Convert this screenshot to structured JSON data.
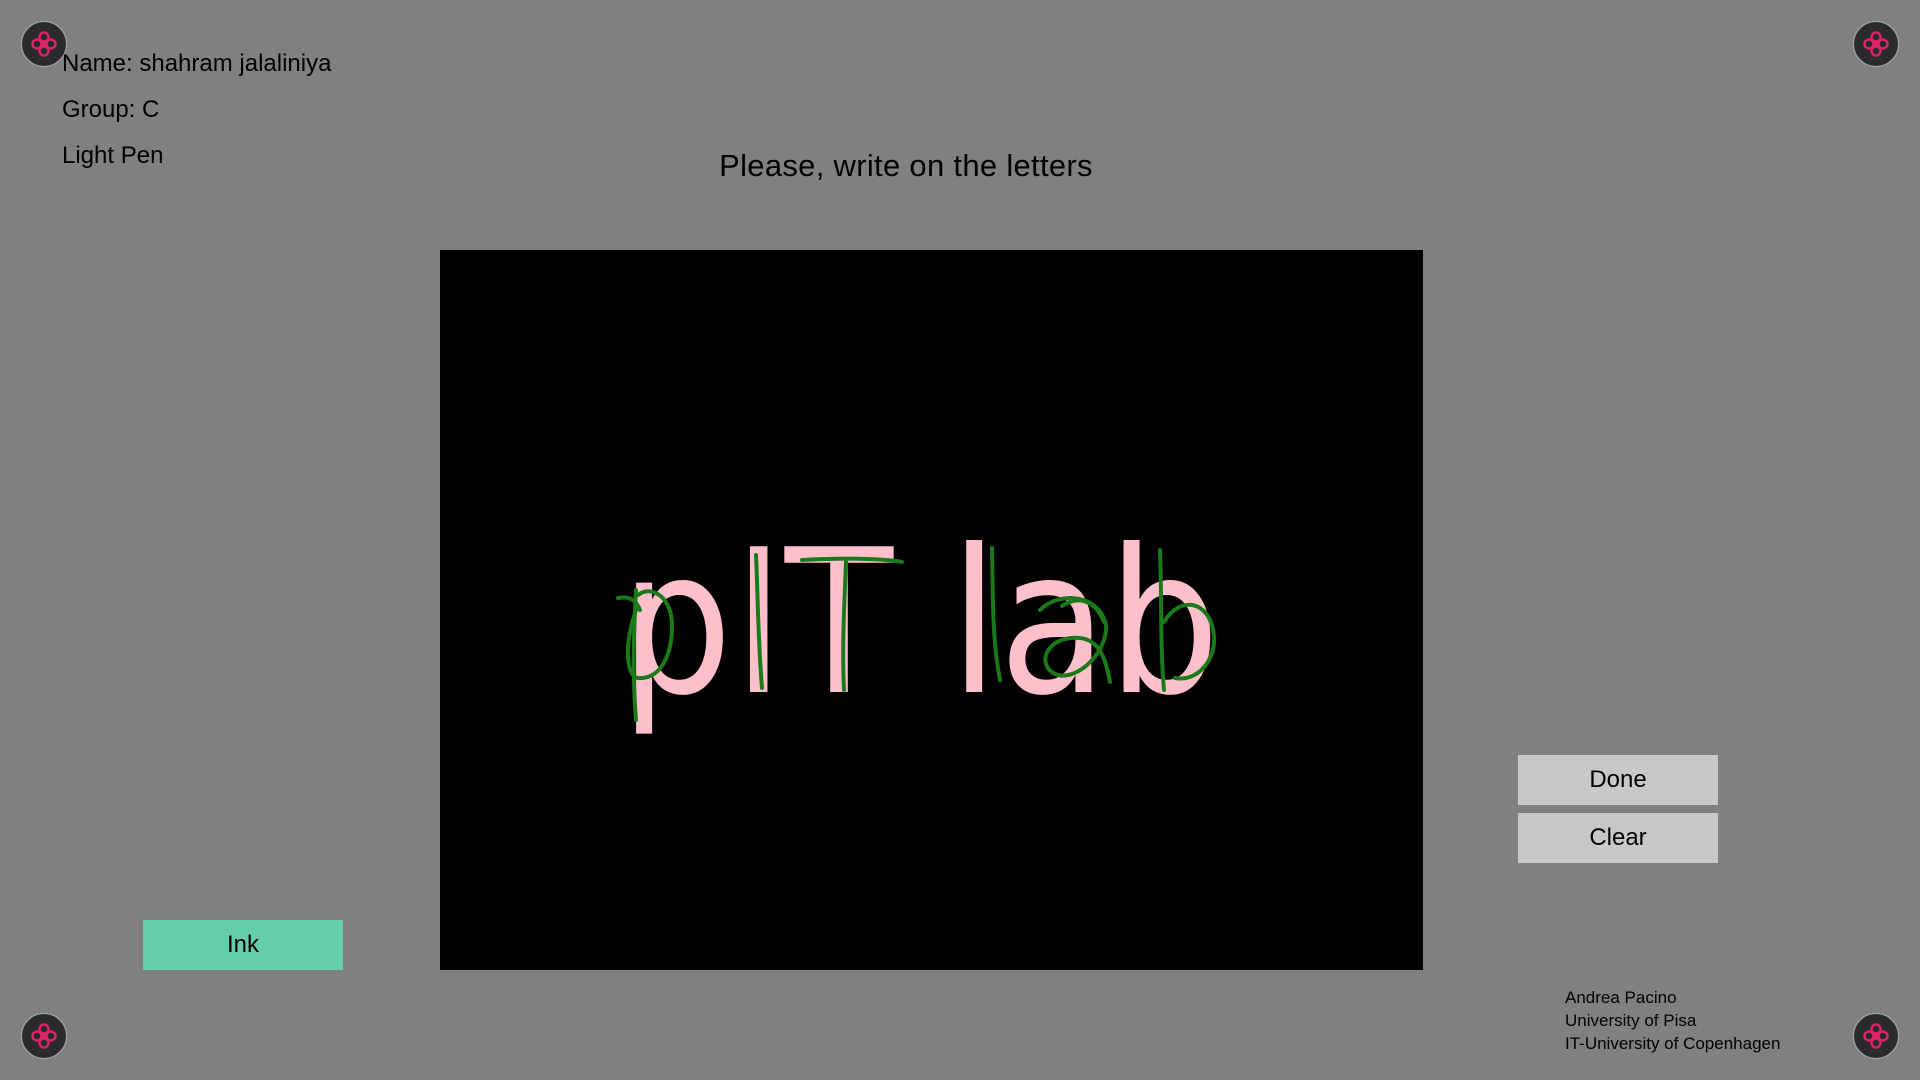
{
  "participant": {
    "name": "Name: shahram jalaliniya",
    "group": "Group: C",
    "device": "Light Pen"
  },
  "instruction": "Please, write on the letters",
  "canvas": {
    "target_text": "pIT lab",
    "background_color": "#000000",
    "letter_color": "#ffc0cb",
    "ink_color": "#1a7a1a"
  },
  "buttons": {
    "done_label": "Done",
    "clear_label": "Clear",
    "ink_label": "Ink"
  },
  "credits": [
    "Andrea Pacino",
    "University of Pisa",
    "IT-University of Copenhagen"
  ],
  "colors": {
    "page_background": "#808080",
    "button_gray": "#c8c8c8",
    "ink_button": "#66cdaa",
    "marker_accent": "#e0246e"
  },
  "icons": {
    "corner_marker": "fiducial-marker-icon"
  }
}
